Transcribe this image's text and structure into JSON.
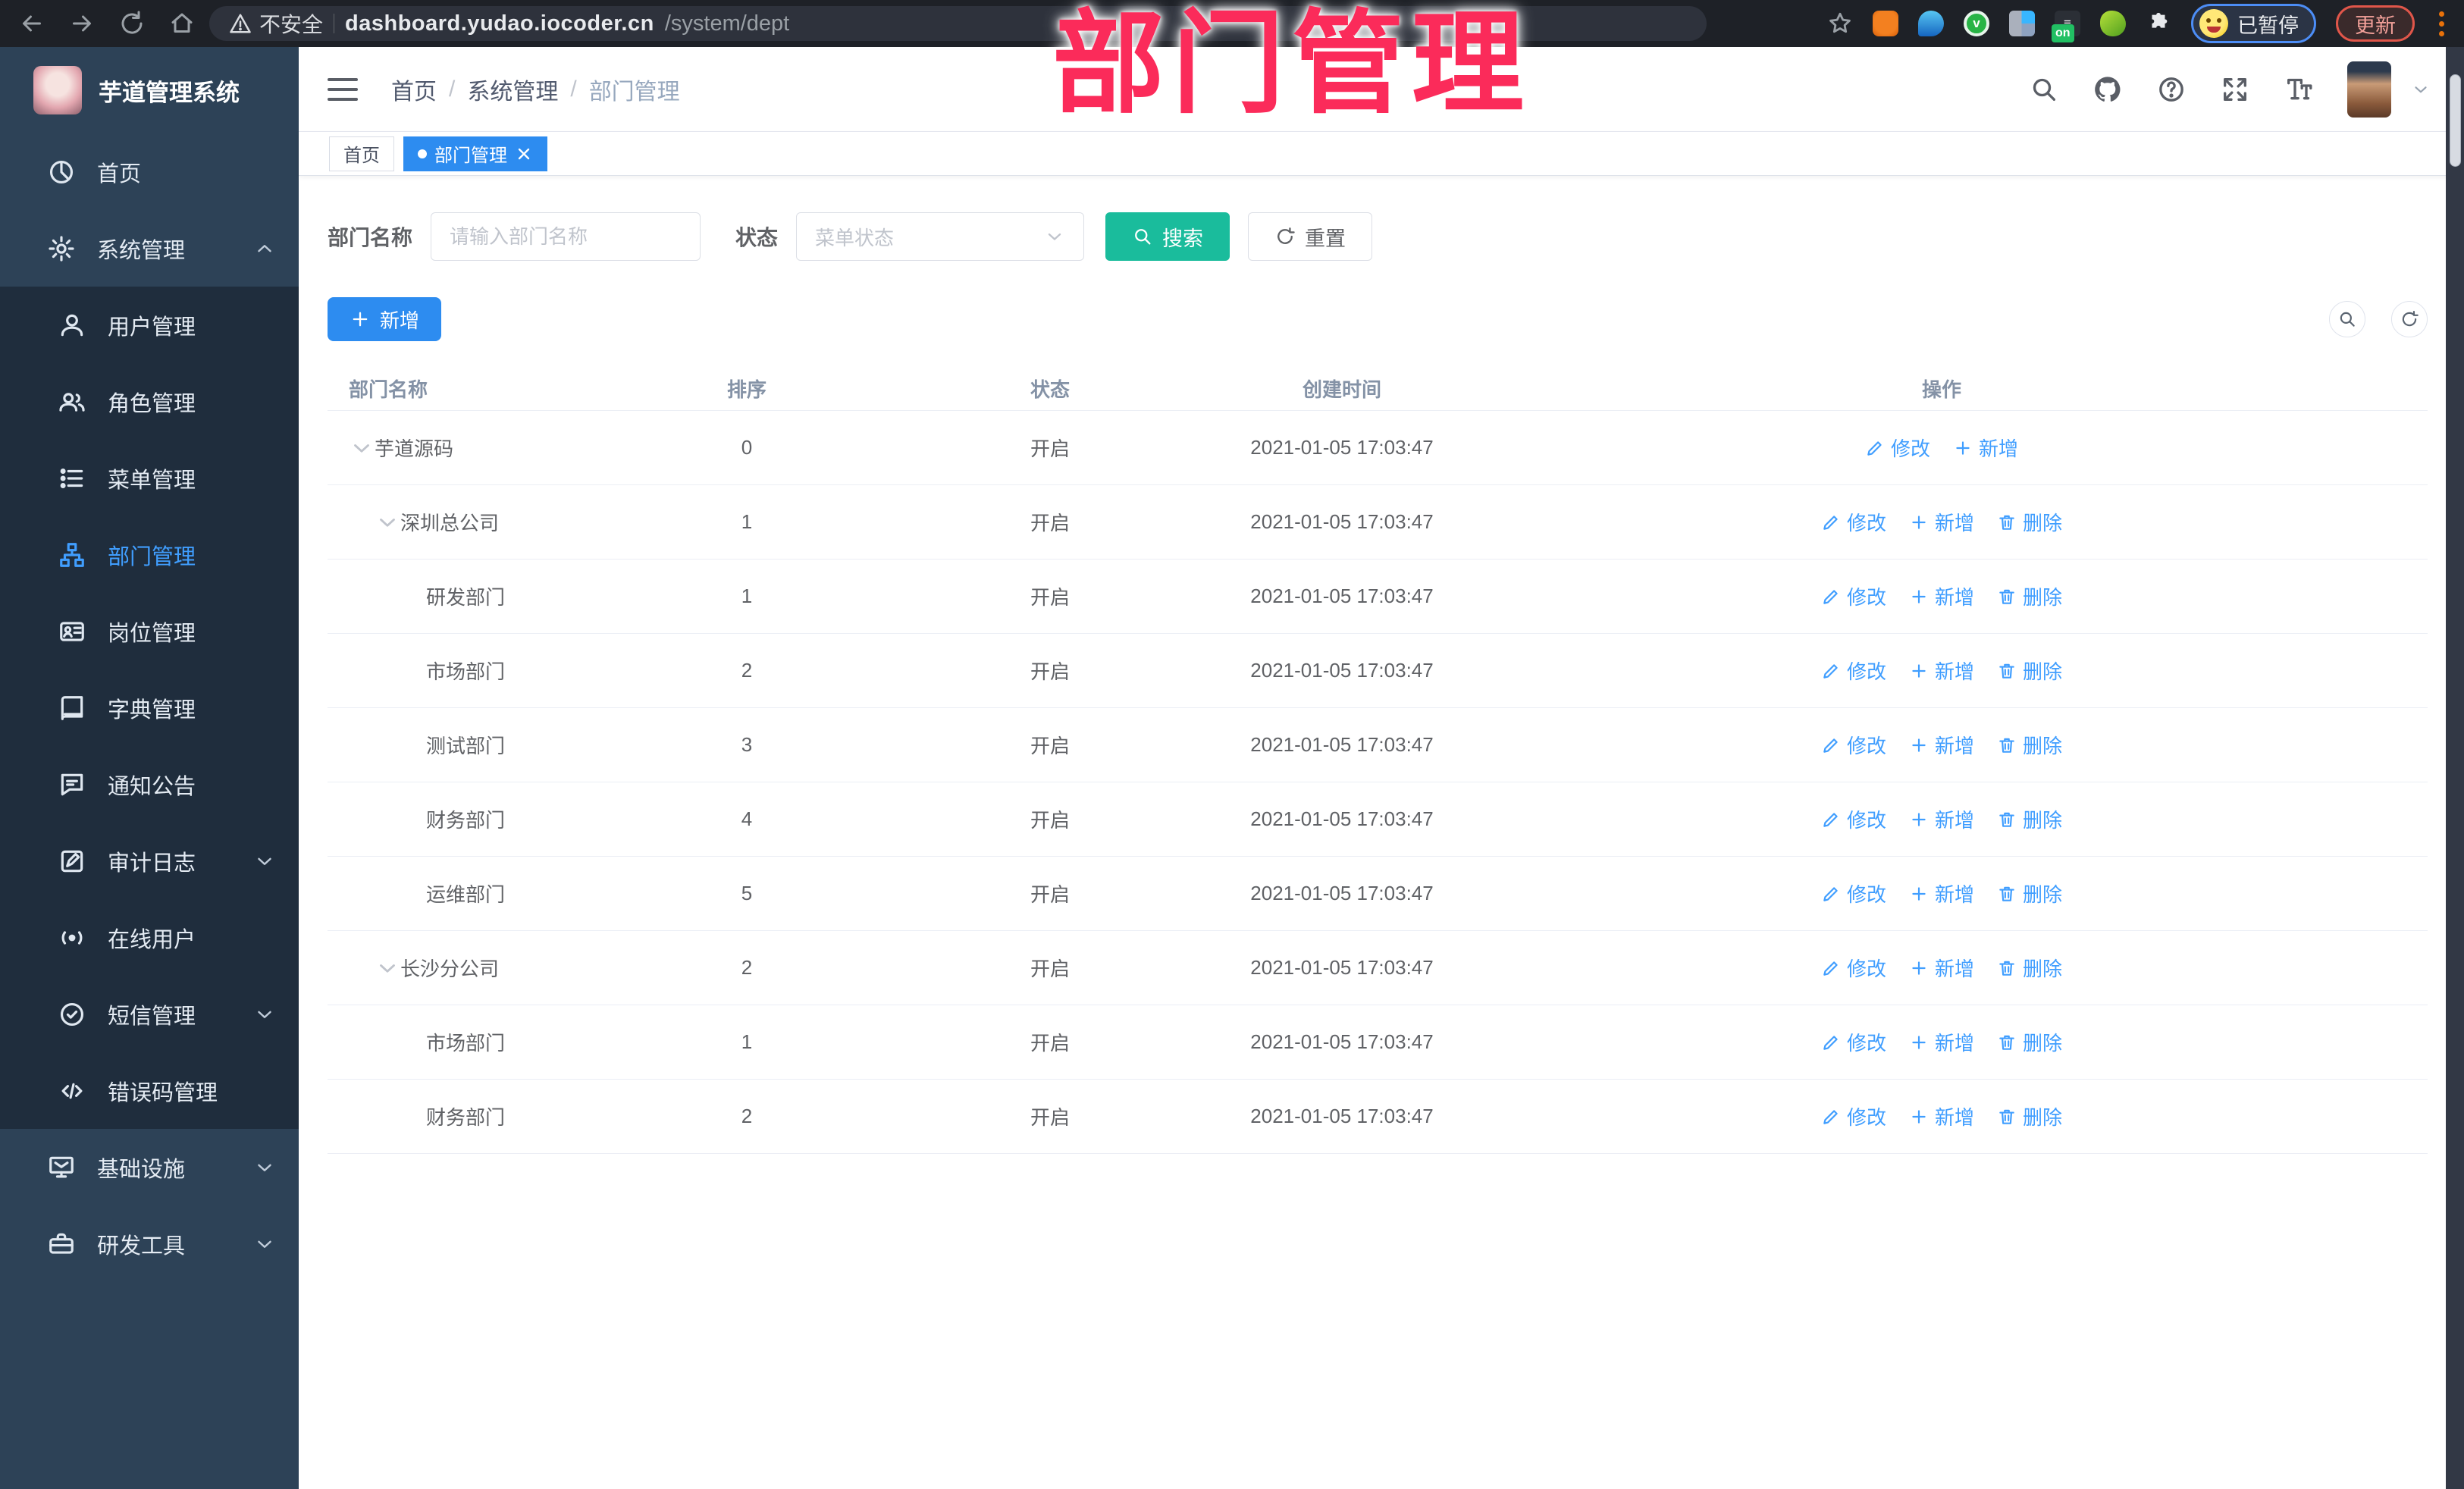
{
  "colors": {
    "accent_blue": "#2d8cf0",
    "link_blue": "#409eff",
    "search_teal": "#1abc9c",
    "overlay_pink": "#fb2b5a",
    "sidebar_bg": "#2d4257",
    "submenu_bg": "#1f2d3d",
    "chrome_bar": "#1e2127"
  },
  "browser": {
    "security_label": "不安全",
    "url_domain": "dashboard.yudao.iocoder.cn",
    "url_path": "/system/dept",
    "profile_status": "已暂停",
    "update_label": "更新",
    "extensions": [
      {
        "name": "adblock-orange-icon",
        "style": "ext-orange",
        "glyph": ""
      },
      {
        "name": "map-pin-blue-icon",
        "style": "ext-bluepin",
        "glyph": ""
      },
      {
        "name": "v-green-icon",
        "style": "ext-green",
        "glyph": "v"
      },
      {
        "name": "grid-blue-icon",
        "style": "ext-grid",
        "glyph": ""
      },
      {
        "name": "onetab-on-icon",
        "style": "ext-dark",
        "glyph": "≡",
        "badge": "on"
      },
      {
        "name": "leaf-green-icon",
        "style": "ext-leaf",
        "glyph": ""
      }
    ]
  },
  "overlay_title": "部门管理",
  "app": {
    "title": "芋道管理系统"
  },
  "breadcrumb": [
    "首页",
    "系统管理",
    "部门管理"
  ],
  "sidebar": {
    "menu": [
      {
        "label": "首页",
        "icon": "home"
      },
      {
        "label": "系统管理",
        "icon": "gear",
        "chevron": "up"
      },
      {
        "label": "用户管理",
        "icon": "user",
        "sub": true
      },
      {
        "label": "角色管理",
        "icon": "users",
        "sub": true
      },
      {
        "label": "菜单管理",
        "icon": "list",
        "sub": true
      },
      {
        "label": "部门管理",
        "icon": "tree",
        "sub": true,
        "active": true
      },
      {
        "label": "岗位管理",
        "icon": "badge",
        "sub": true
      },
      {
        "label": "字典管理",
        "icon": "book",
        "sub": true
      },
      {
        "label": "通知公告",
        "icon": "message",
        "sub": true
      },
      {
        "label": "审计日志",
        "icon": "log",
        "sub": true,
        "chevron": "down"
      },
      {
        "label": "在线用户",
        "icon": "online",
        "sub": true
      },
      {
        "label": "短信管理",
        "icon": "sms",
        "sub": true,
        "chevron": "down"
      },
      {
        "label": "错误码管理",
        "icon": "code",
        "sub": true
      },
      {
        "label": "基础设施",
        "icon": "infra",
        "chevron": "down"
      },
      {
        "label": "研发工具",
        "icon": "tools",
        "chevron": "down"
      }
    ]
  },
  "tabs": [
    {
      "label": "首页"
    },
    {
      "label": "部门管理",
      "active": true,
      "closable": true
    }
  ],
  "filters": {
    "dept_label": "部门名称",
    "dept_placeholder": "请输入部门名称",
    "status_label": "状态",
    "status_placeholder": "菜单状态",
    "search_label": "搜索",
    "reset_label": "重置"
  },
  "toolbar": {
    "add_label": "新增"
  },
  "table": {
    "headers": [
      "部门名称",
      "排序",
      "状态",
      "创建时间",
      "操作"
    ],
    "action_defs": {
      "edit": {
        "label": "修改",
        "icon": "edit"
      },
      "add": {
        "label": "新增",
        "icon": "plus"
      },
      "del": {
        "label": "删除",
        "icon": "trash"
      }
    },
    "rows": [
      {
        "name": "芋道源码",
        "level": 0,
        "expandable": true,
        "sort": "0",
        "status": "开启",
        "created": "2021-01-05 17:03:47",
        "actions": [
          "edit",
          "add"
        ]
      },
      {
        "name": "深圳总公司",
        "level": 1,
        "expandable": true,
        "sort": "1",
        "status": "开启",
        "created": "2021-01-05 17:03:47",
        "actions": [
          "edit",
          "add",
          "del"
        ]
      },
      {
        "name": "研发部门",
        "level": 2,
        "expandable": false,
        "sort": "1",
        "status": "开启",
        "created": "2021-01-05 17:03:47",
        "actions": [
          "edit",
          "add",
          "del"
        ]
      },
      {
        "name": "市场部门",
        "level": 2,
        "expandable": false,
        "sort": "2",
        "status": "开启",
        "created": "2021-01-05 17:03:47",
        "actions": [
          "edit",
          "add",
          "del"
        ]
      },
      {
        "name": "测试部门",
        "level": 2,
        "expandable": false,
        "sort": "3",
        "status": "开启",
        "created": "2021-01-05 17:03:47",
        "actions": [
          "edit",
          "add",
          "del"
        ]
      },
      {
        "name": "财务部门",
        "level": 2,
        "expandable": false,
        "sort": "4",
        "status": "开启",
        "created": "2021-01-05 17:03:47",
        "actions": [
          "edit",
          "add",
          "del"
        ]
      },
      {
        "name": "运维部门",
        "level": 2,
        "expandable": false,
        "sort": "5",
        "status": "开启",
        "created": "2021-01-05 17:03:47",
        "actions": [
          "edit",
          "add",
          "del"
        ]
      },
      {
        "name": "长沙分公司",
        "level": 1,
        "expandable": true,
        "sort": "2",
        "status": "开启",
        "created": "2021-01-05 17:03:47",
        "actions": [
          "edit",
          "add",
          "del"
        ]
      },
      {
        "name": "市场部门",
        "level": 2,
        "expandable": false,
        "sort": "1",
        "status": "开启",
        "created": "2021-01-05 17:03:47",
        "actions": [
          "edit",
          "add",
          "del"
        ]
      },
      {
        "name": "财务部门",
        "level": 2,
        "expandable": false,
        "sort": "2",
        "status": "开启",
        "created": "2021-01-05 17:03:47",
        "actions": [
          "edit",
          "add",
          "del"
        ]
      }
    ]
  }
}
